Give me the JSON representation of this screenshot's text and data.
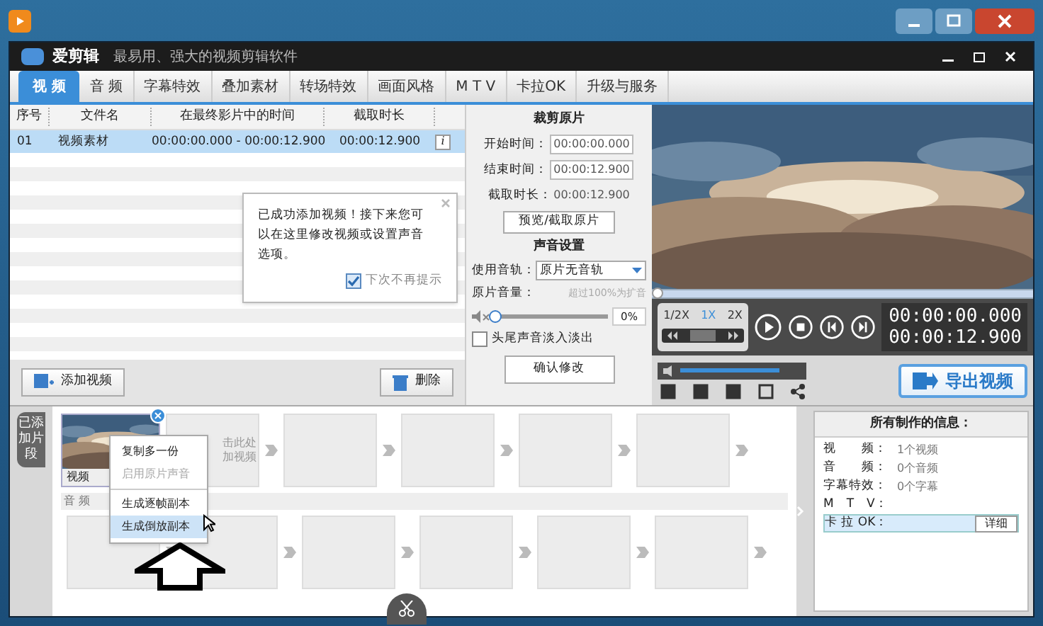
{
  "app": {
    "name": "爱剪辑",
    "tagline": "最易用、强大的视频剪辑软件"
  },
  "tabs": [
    {
      "label": "视 频",
      "selected": true
    },
    {
      "label": "音 频",
      "selected": false
    },
    {
      "label": "字幕特效",
      "selected": false
    },
    {
      "label": "叠加素材",
      "selected": false
    },
    {
      "label": "转场特效",
      "selected": false
    },
    {
      "label": "画面风格",
      "selected": false
    },
    {
      "label": "M T V",
      "selected": false
    },
    {
      "label": "卡拉OK",
      "selected": false
    },
    {
      "label": "升级与服务",
      "selected": false
    }
  ],
  "table": {
    "columns": [
      "序号",
      "文件名",
      "在最终影片中的时间",
      "截取时长"
    ],
    "rows": [
      {
        "cells": [
          "01",
          "视频素材",
          "00:00:00.000 - 00:00:12.900",
          "00:00:12.900"
        ],
        "info": "i",
        "selected": true
      }
    ]
  },
  "tooltip": {
    "text": "已成功添加视频！接下来您可以在这里修改视频或设置声音选项。",
    "checkbox": {
      "label": "下次不再提示",
      "checked": true
    }
  },
  "table_buttons": [
    {
      "label": "添加视频",
      "kind": "add"
    },
    {
      "label": "删除",
      "kind": "delete"
    }
  ],
  "trim": {
    "title": "裁剪原片",
    "fields": [
      {
        "label": "开始时间：",
        "value": "00:00:00.000",
        "kind": "input"
      },
      {
        "label": "结束时间：",
        "value": "00:00:12.900",
        "kind": "input"
      },
      {
        "label": "截取时长：",
        "value": "00:00:12.900",
        "kind": "text"
      }
    ],
    "button": "预览/截取原片"
  },
  "sound": {
    "title": "声音设置",
    "track_label": "使用音轨：",
    "track_value": "原片无音轨",
    "volume_label": "原片音量：",
    "volume_hint": "超过100%为扩音",
    "volume": {
      "level": 0
    },
    "volume_value": "0%",
    "fade": {
      "label": "头尾声音淡入淡出",
      "checked": false
    },
    "confirm": "确认修改"
  },
  "player": {
    "progress": {
      "level": 0
    },
    "speeds": [
      {
        "label": "1/2X",
        "selected": false
      },
      {
        "label": "1X",
        "selected": true
      },
      {
        "label": "2X",
        "selected": false
      }
    ],
    "volume": {
      "level": 1
    },
    "time_current": "00:00:00.000",
    "time_total": "00:00:12.900",
    "export": "导出视频"
  },
  "timeline": {
    "label": "已添加片段",
    "clip_title": "视频",
    "slot_hint": [
      "击此处",
      "加视频"
    ],
    "audio_label": "音 频"
  },
  "context_menu": [
    {
      "label": "复制多一份",
      "disabled": false,
      "selected": false
    },
    {
      "label": "启用原片声音",
      "disabled": true,
      "selected": false
    },
    {
      "label": "生成逐帧副本",
      "disabled": false,
      "selected": false
    },
    {
      "label": "生成倒放副本",
      "disabled": false,
      "selected": true
    }
  ],
  "info": {
    "title": "所有制作的信息：",
    "rows": [
      {
        "label": "视　　频：",
        "value": "1个视频",
        "selected": false
      },
      {
        "label": "音　　频：",
        "value": "0个音频",
        "selected": false
      },
      {
        "label": "字幕特效：",
        "value": "0个字幕",
        "selected": false
      },
      {
        "label": "M　T　V：",
        "selected": false
      },
      {
        "label": "卡 拉 OK：",
        "selected": true,
        "button": "详细"
      }
    ]
  }
}
